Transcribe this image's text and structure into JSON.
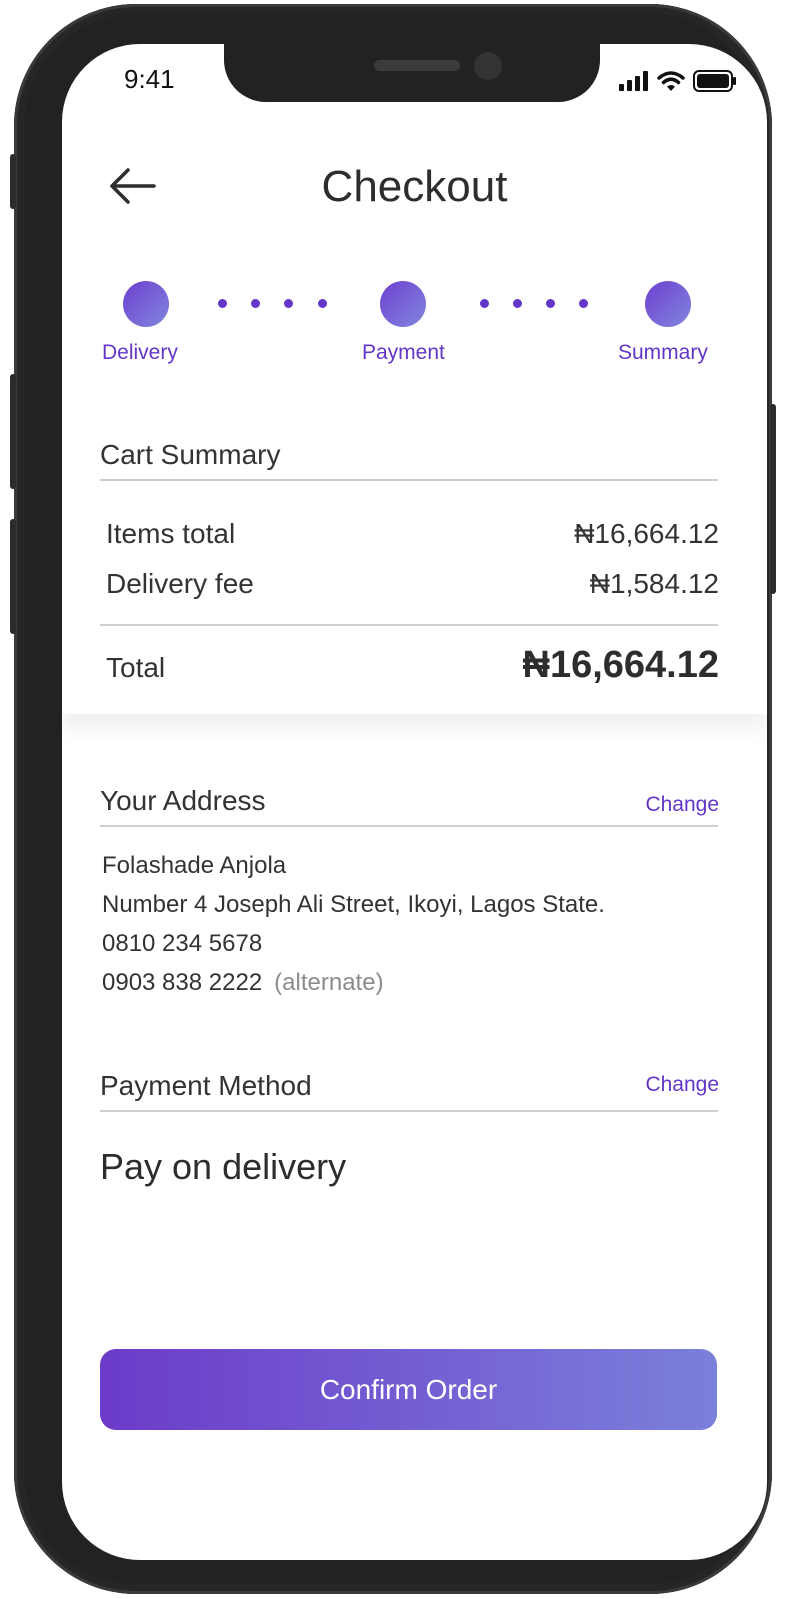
{
  "status_bar": {
    "time": "9:41"
  },
  "header": {
    "title": "Checkout"
  },
  "stepper": {
    "steps": [
      {
        "label": "Delivery"
      },
      {
        "label": "Payment"
      },
      {
        "label": "Summary"
      }
    ],
    "accent_color": "#6336c9"
  },
  "cart_summary": {
    "title": "Cart Summary",
    "items_total_label": "Items total",
    "items_total_value": "₦16,664.12",
    "delivery_fee_label": "Delivery fee",
    "delivery_fee_value": "₦1,584.12",
    "total_label": "Total",
    "total_value": "₦16,664.12"
  },
  "address": {
    "title": "Your Address",
    "change_label": "Change",
    "name": "Folashade Anjola",
    "street": "Number 4 Joseph Ali Street, Ikoyi, Lagos State.",
    "phone_primary": "0810 234 5678",
    "phone_alternate": "0903 838 2222",
    "alternate_note": "(alternate)"
  },
  "payment": {
    "title": "Payment Method",
    "change_label": "Change",
    "method": "Pay on delivery"
  },
  "confirm_button": {
    "label": "Confirm Order"
  },
  "icons": [
    "back-arrow-icon",
    "signal-icon",
    "wifi-icon",
    "battery-icon"
  ]
}
